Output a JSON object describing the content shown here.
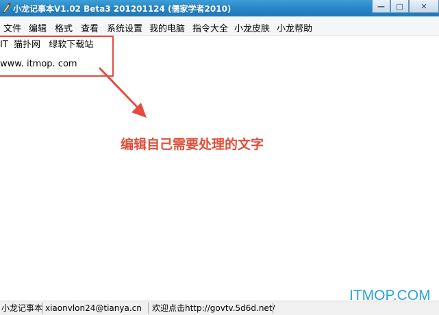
{
  "window": {
    "title": "小龙记事本V1.02 Beta3 201201124 (儒家学者2010)",
    "minimize_glyph": "—",
    "maximize_glyph": "□",
    "close_glyph": "✕"
  },
  "menu": {
    "items": [
      "文件",
      "编辑",
      "格式",
      "查看",
      "系统设置",
      "我的电脑",
      "指令大全",
      "小龙皮肤",
      "小龙帮助"
    ]
  },
  "editor": {
    "lines": [
      "IT  猫扑网   绿软下载站",
      "www. itmop. com"
    ]
  },
  "annotation": {
    "text": "编辑自己需要处理的文字",
    "color": "#e04f3c"
  },
  "statusbar": {
    "app_name": "小龙记事本",
    "email": "xiaonvlon24@tianya.cn",
    "website": "欢迎点击http://govtv.5d6d.net/"
  },
  "watermark": {
    "text": "ITMOP.COM",
    "color": "#29a3d9"
  }
}
